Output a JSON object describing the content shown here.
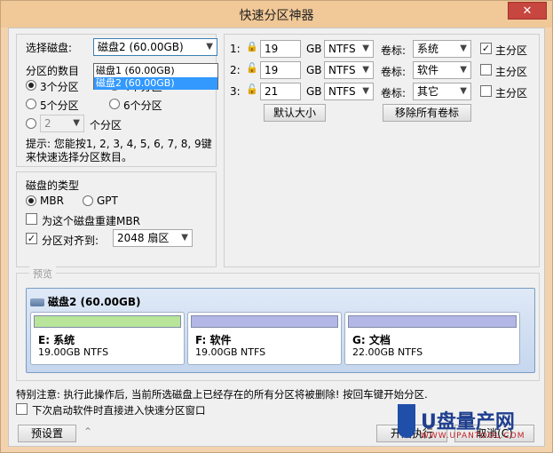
{
  "window": {
    "title": "快速分区神器",
    "close": "✕"
  },
  "disk_select": {
    "label": "选择磁盘:",
    "selected": "磁盘2 (60.00GB)",
    "options": [
      "磁盘1 (60.00GB)",
      "磁盘2 (60.00GB)"
    ]
  },
  "partition_count": {
    "label": "分区的数目",
    "options": [
      "3个分区",
      "4个分区",
      "5个分区",
      "6个分区"
    ],
    "custom_value": "2",
    "custom_suffix": "个分区",
    "tip": "提示: 您能按1, 2, 3, 4, 5, 6, 7, 8, 9键来快速选择分区数目。"
  },
  "disk_type": {
    "title": "磁盘的类型",
    "mbr": "MBR",
    "gpt": "GPT",
    "rebuild": "为这个磁盘重建MBR",
    "align_label": "分区对齐到:",
    "align_value": "2048 扇区"
  },
  "partitions": [
    {
      "index": "1:",
      "size": "19",
      "unit": "GB",
      "fs": "NTFS",
      "label_caption": "卷标:",
      "label": "系统",
      "primary": "主分区",
      "primary_checked": true
    },
    {
      "index": "2:",
      "size": "19",
      "unit": "GB",
      "fs": "NTFS",
      "label_caption": "卷标:",
      "label": "软件",
      "primary": "主分区",
      "primary_checked": false
    },
    {
      "index": "3:",
      "size": "21",
      "unit": "GB",
      "fs": "NTFS",
      "label_caption": "卷标:",
      "label": "其它",
      "primary": "主分区",
      "primary_checked": false
    }
  ],
  "buttons": {
    "default_size": "默认大小",
    "remove_labels": "移除所有卷标",
    "preset": "预设置",
    "start": "开始执行",
    "cancel": "取消(C)"
  },
  "preview": {
    "legend": "预览",
    "disk_name": "磁盘2 (60.00GB)",
    "parts": [
      {
        "name": "E: 系统",
        "info": "19.00GB NTFS",
        "color": "#b8e59a"
      },
      {
        "name": "F: 软件",
        "info": "19.00GB NTFS",
        "color": "#b3b7e6"
      },
      {
        "name": "G: 文档",
        "info": "22.00GB NTFS",
        "color": "#b3b7e6"
      }
    ]
  },
  "warning": "特别注意: 执行此操作后, 当前所选磁盘上已经存在的所有分区将被删除! 按回车键开始分区.",
  "next_time": "下次启动软件时直接进入快速分区窗口",
  "watermark": {
    "text": "U盘量产网",
    "url": "WWW.UPANTOOL.COM"
  }
}
